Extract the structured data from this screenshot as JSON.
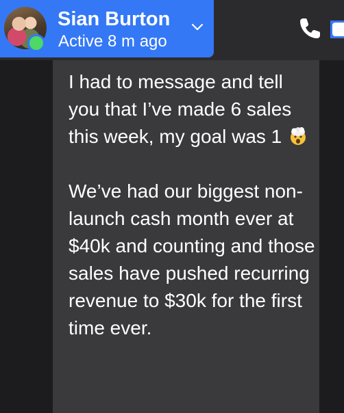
{
  "header": {
    "contact_name": "Sian Burton",
    "status": "Active 8 m ago",
    "accent_color": "#3478f6",
    "presence_color": "#4cd964",
    "icons": [
      "avatar",
      "chevron-down-icon",
      "phone-icon",
      "video-icon"
    ]
  },
  "message": {
    "paragraph_1_text": "I had to message and tell you that I’ve made 6 sales this week, my goal was 1",
    "emoji": "exploding-head-emoji",
    "paragraph_2": "We’ve had our biggest non-launch cash month ever at $40k and counting and those sales have pushed recurring revenue to $30k for the first time ever."
  }
}
